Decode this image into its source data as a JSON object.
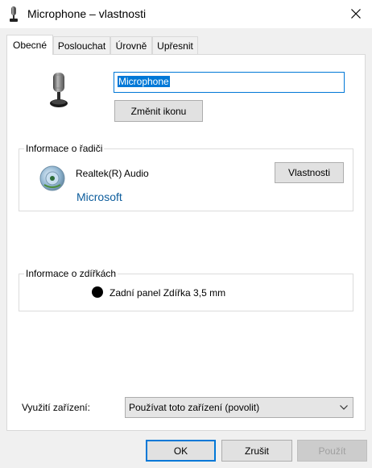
{
  "window": {
    "title": "Microphone – vlastnosti",
    "icon": "microphone-icon"
  },
  "tabs": [
    {
      "label": "Obecné",
      "active": true
    },
    {
      "label": "Poslouchat",
      "active": false
    },
    {
      "label": "Úrovně",
      "active": false
    },
    {
      "label": "Upřesnit",
      "active": false
    }
  ],
  "general": {
    "device_name": "Microphone",
    "change_icon_label": "Změnit ikonu",
    "controller": {
      "group_label": "Informace o řadiči",
      "name": "Realtek(R) Audio",
      "vendor": "Microsoft",
      "properties_label": "Vlastnosti"
    },
    "jack": {
      "group_label": "Informace o zdířkách",
      "location": "Zadní panel Zdířka 3,5 mm",
      "color": "#000000"
    },
    "usage": {
      "label": "Využití zařízení:",
      "selected": "Používat toto zařízení (povolit)"
    }
  },
  "footer": {
    "ok_label": "OK",
    "cancel_label": "Zrušit",
    "apply_label": "Použít"
  },
  "colors": {
    "accent": "#0078d7",
    "vendor_link": "#0c5c9c"
  }
}
